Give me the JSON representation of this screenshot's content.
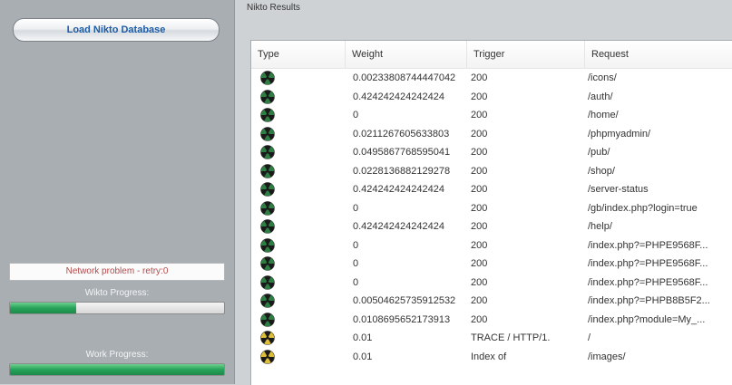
{
  "left_panel": {
    "load_button": "Load Nikto Database",
    "network_status": "Network problem - retry:0",
    "wikto_progress_label": "Wikto Progress:",
    "wikto_progress": 0.31,
    "work_progress_label": "Work Progress:",
    "work_progress": 1.0
  },
  "results": {
    "title": "Nikto Results",
    "columns": [
      "Type",
      "Weight",
      "Trigger",
      "Request"
    ],
    "rows": [
      {
        "type_icon": "green-radiation-icon",
        "weight": "0.00233808744447042",
        "trigger": "200",
        "request": "/icons/"
      },
      {
        "type_icon": "green-radiation-icon",
        "weight": "0.424242424242424",
        "trigger": "200",
        "request": "/auth/"
      },
      {
        "type_icon": "green-radiation-icon",
        "weight": "0",
        "trigger": "200",
        "request": "/home/"
      },
      {
        "type_icon": "green-radiation-icon",
        "weight": "0.0211267605633803",
        "trigger": "200",
        "request": "/phpmyadmin/"
      },
      {
        "type_icon": "green-radiation-icon",
        "weight": "0.0495867768595041",
        "trigger": "200",
        "request": "/pub/"
      },
      {
        "type_icon": "green-radiation-icon",
        "weight": "0.0228136882129278",
        "trigger": "200",
        "request": "/shop/"
      },
      {
        "type_icon": "green-radiation-icon",
        "weight": "0.424242424242424",
        "trigger": "200",
        "request": "/server-status"
      },
      {
        "type_icon": "green-radiation-icon",
        "weight": "0",
        "trigger": "200",
        "request": "/gb/index.php?login=true"
      },
      {
        "type_icon": "green-radiation-icon",
        "weight": "0.424242424242424",
        "trigger": "200",
        "request": "/help/"
      },
      {
        "type_icon": "green-radiation-icon",
        "weight": "0",
        "trigger": "200",
        "request": "/index.php?=PHPE9568F..."
      },
      {
        "type_icon": "green-radiation-icon",
        "weight": "0",
        "trigger": "200",
        "request": "/index.php?=PHPE9568F..."
      },
      {
        "type_icon": "green-radiation-icon",
        "weight": "0",
        "trigger": "200",
        "request": "/index.php?=PHPE9568F..."
      },
      {
        "type_icon": "green-radiation-icon",
        "weight": "0.00504625735912532",
        "trigger": "200",
        "request": "/index.php?=PHPB8B5F2..."
      },
      {
        "type_icon": "green-radiation-icon",
        "weight": "0.0108695652173913",
        "trigger": "200",
        "request": "/index.php?module=My_..."
      },
      {
        "type_icon": "yellow-radiation-icon",
        "weight": "0.01",
        "trigger": "TRACE / HTTP/1.",
        "request": "/"
      },
      {
        "type_icon": "yellow-radiation-icon",
        "weight": "0.01",
        "trigger": "Index of",
        "request": "/images/"
      }
    ]
  },
  "colors": {
    "green_icon": "#2e7f43",
    "yellow_icon": "#e0bf38",
    "accent_button_text": "#1c5ca8",
    "progress_green": "#27a35a",
    "network_status_text": "#b24b4b"
  }
}
